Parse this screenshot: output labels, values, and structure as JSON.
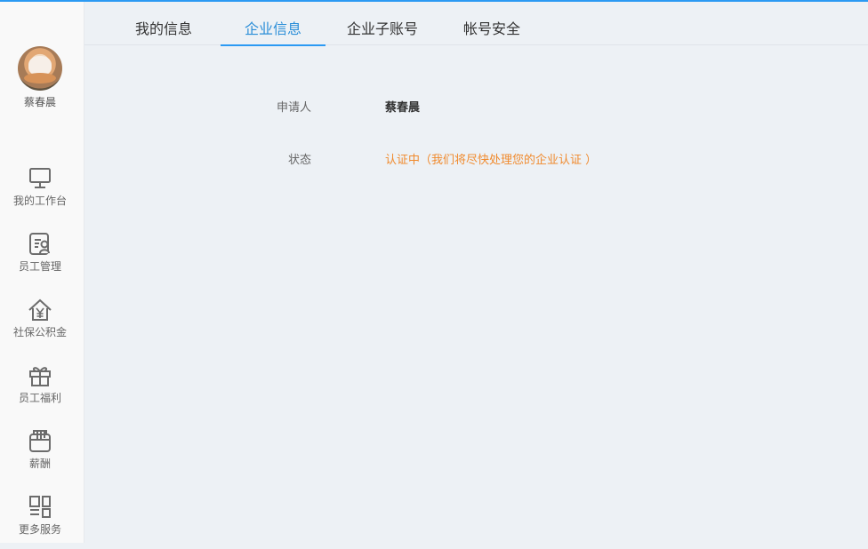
{
  "app": {
    "accent_color": "#2b9af3",
    "status_color": "#f08a2d"
  },
  "user": {
    "name": "蔡春晨",
    "avatar_icon": "user-avatar"
  },
  "sidebar": {
    "items": [
      {
        "label": "我的工作台",
        "icon": "monitor-icon"
      },
      {
        "label": "员工管理",
        "icon": "employee-card-icon"
      },
      {
        "label": "社保公积金",
        "icon": "house-yen-icon"
      },
      {
        "label": "员工福利",
        "icon": "gift-icon"
      },
      {
        "label": "薪酬",
        "icon": "wallet-icon"
      },
      {
        "label": "更多服务",
        "icon": "grid-services-icon"
      }
    ]
  },
  "tabs": [
    {
      "label": "我的信息"
    },
    {
      "label": "企业信息",
      "active": true
    },
    {
      "label": "企业子账号"
    },
    {
      "label": "帐号安全"
    }
  ],
  "enterprise": {
    "applicant_label": "申请人",
    "applicant_value": "蔡春晨",
    "status_label": "状态",
    "status_value": "认证中（我们将尽快处理您的企业认证 ）"
  }
}
